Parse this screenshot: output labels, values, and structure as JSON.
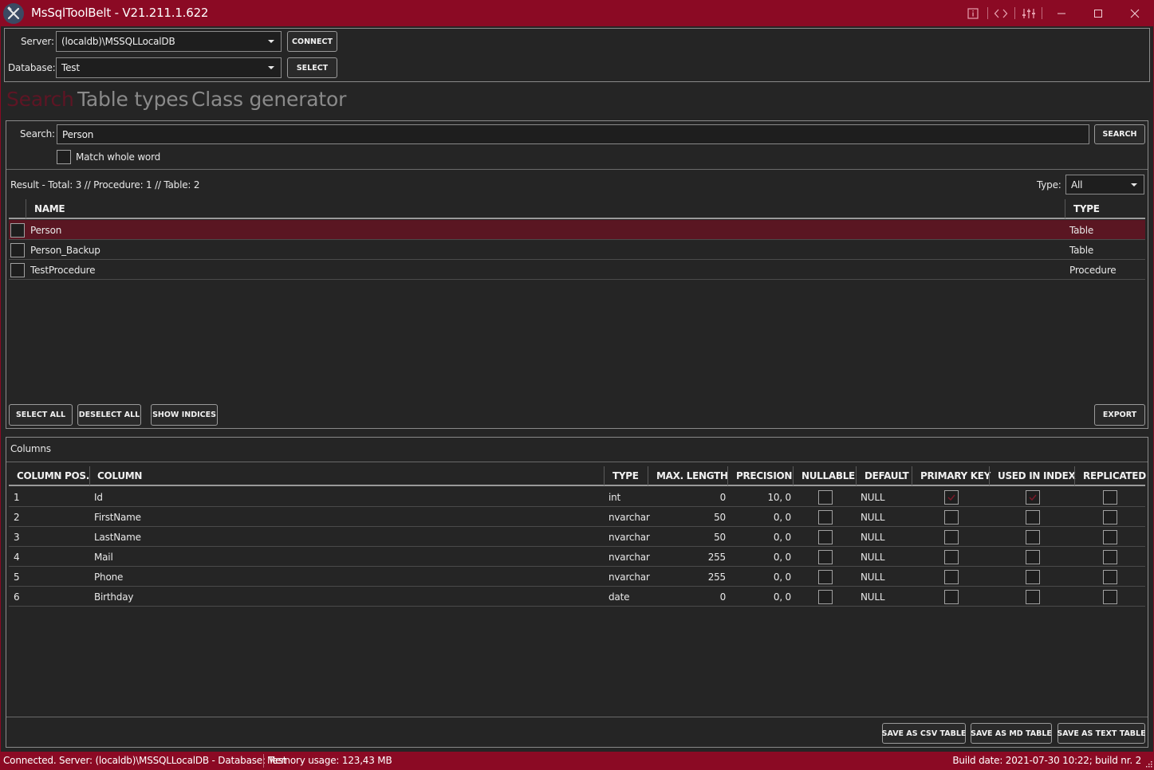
{
  "window": {
    "title": "MsSqlToolBelt - V21.211.1.622",
    "icons": [
      "info-icon",
      "code-icon",
      "settings-sliders-icon",
      "minimize-icon",
      "maximize-icon",
      "close-icon"
    ],
    "accent_color": "#8b0a24"
  },
  "connection": {
    "server_label": "Server:",
    "server_value": "(localdb)\\MSSQLLocalDB",
    "connect_label": "CONNECT",
    "database_label": "Database:",
    "database_value": "Test",
    "select_label": "SELECT"
  },
  "tabs": [
    {
      "label": "Search",
      "active": true
    },
    {
      "label": "Table types",
      "active": false
    },
    {
      "label": "Class generator",
      "active": false
    }
  ],
  "search": {
    "label": "Search:",
    "value": "Person",
    "button": "SEARCH",
    "match_whole_word": "Match whole word",
    "match_whole_word_checked": false
  },
  "results": {
    "summary": "Result - Total: 3 // Procedure: 1 // Table: 2",
    "type_label": "Type:",
    "type_value": "All",
    "headers": {
      "name": "NAME",
      "type": "TYPE"
    },
    "rows": [
      {
        "name": "Person",
        "type": "Table",
        "selected": true
      },
      {
        "name": "Person_Backup",
        "type": "Table",
        "selected": false
      },
      {
        "name": "TestProcedure",
        "type": "Procedure",
        "selected": false
      }
    ],
    "buttons": {
      "select_all": "SELECT ALL",
      "deselect_all": "DESELECT ALL",
      "show_indices": "SHOW INDICES",
      "export": "EXPORT"
    }
  },
  "columns": {
    "title": "Columns",
    "headers": [
      "COLUMN POS.",
      "COLUMN",
      "TYPE",
      "MAX. LENGTH",
      "PRECISION",
      "NULLABLE",
      "DEFAULT",
      "PRIMARY KEY",
      "USED IN INDEX",
      "REPLICATED"
    ],
    "rows": [
      {
        "pos": "1",
        "column": "Id",
        "type": "int",
        "max_length": "0",
        "precision": "10, 0",
        "nullable": false,
        "default": "NULL",
        "primary_key": true,
        "used_in_index": true,
        "replicated": false
      },
      {
        "pos": "2",
        "column": "FirstName",
        "type": "nvarchar",
        "max_length": "50",
        "precision": "0, 0",
        "nullable": false,
        "default": "NULL",
        "primary_key": false,
        "used_in_index": false,
        "replicated": false
      },
      {
        "pos": "3",
        "column": "LastName",
        "type": "nvarchar",
        "max_length": "50",
        "precision": "0, 0",
        "nullable": false,
        "default": "NULL",
        "primary_key": false,
        "used_in_index": false,
        "replicated": false
      },
      {
        "pos": "4",
        "column": "Mail",
        "type": "nvarchar",
        "max_length": "255",
        "precision": "0, 0",
        "nullable": false,
        "default": "NULL",
        "primary_key": false,
        "used_in_index": false,
        "replicated": false
      },
      {
        "pos": "5",
        "column": "Phone",
        "type": "nvarchar",
        "max_length": "255",
        "precision": "0, 0",
        "nullable": false,
        "default": "NULL",
        "primary_key": false,
        "used_in_index": false,
        "replicated": false
      },
      {
        "pos": "6",
        "column": "Birthday",
        "type": "date",
        "max_length": "0",
        "precision": "0, 0",
        "nullable": false,
        "default": "NULL",
        "primary_key": false,
        "used_in_index": false,
        "replicated": false
      }
    ],
    "buttons": {
      "save_csv": "SAVE AS CSV TABLE",
      "save_md": "SAVE AS MD TABLE",
      "save_text": "SAVE AS TEXT TABLE"
    }
  },
  "status": {
    "connection": "Connected. Server: (localdb)\\MSSQLLocalDB - Database: Test",
    "memory": "Memory usage: 123,43 MB",
    "build": "Build date: 2021-07-30 10:22; build nr. 2"
  }
}
